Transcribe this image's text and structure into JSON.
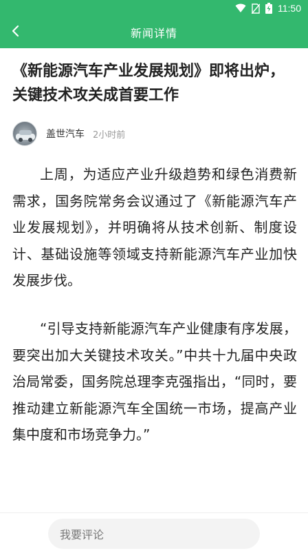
{
  "status_bar": {
    "time": "11:50",
    "icons": [
      "wifi-icon",
      "no-sim-icon",
      "battery-icon"
    ]
  },
  "app_bar": {
    "title": "新闻详情",
    "back_icon": "chevron-left-icon"
  },
  "article": {
    "title": "《新能源汽车产业发展规划》即将出炉，关键技术攻关成首要工作",
    "author": "盖世汽车",
    "time": "2小时前",
    "paragraphs": [
      "上周，为适应产业升级趋势和绿色消费新需求，国务院常务会议通过了《新能源汽车产业发展规划》，并明确将从技术创新、制度设计、基础设施等领域支持新能源汽车产业加快发展步伐。",
      "“引导支持新能源汽车产业健康有序发展，要突出加大关键技术攻关。”中共十九届中央政治局常委，国务院总理李克强指出，“同时，要推动建立新能源汽车全国统一市场，提高产业集中度和市场竞争力。”"
    ]
  },
  "comment": {
    "placeholder": "我要评论"
  },
  "colors": {
    "accent": "#33b86e",
    "text": "#222222",
    "muted": "#999999"
  }
}
